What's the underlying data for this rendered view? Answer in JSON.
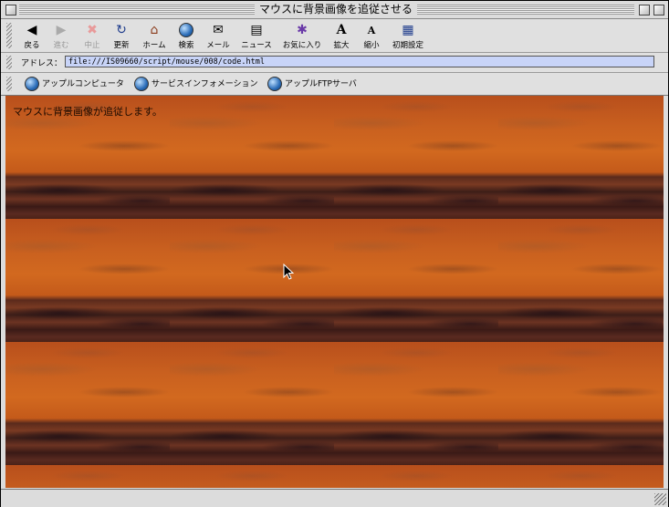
{
  "window": {
    "title": "マウスに背景画像を追従させる"
  },
  "toolbar": {
    "buttons": [
      {
        "label": "戻る",
        "icon": "back-arrow-icon"
      },
      {
        "label": "進む",
        "icon": "forward-arrow-icon"
      },
      {
        "label": "中止",
        "icon": "stop-icon"
      },
      {
        "label": "更新",
        "icon": "refresh-icon"
      },
      {
        "label": "ホーム",
        "icon": "home-icon"
      },
      {
        "label": "検索",
        "icon": "search-globe-icon"
      },
      {
        "label": "メール",
        "icon": "mail-icon"
      },
      {
        "label": "ニュース",
        "icon": "news-icon"
      },
      {
        "label": "お気に入り",
        "icon": "favorites-icon"
      },
      {
        "label": "拡大",
        "icon": "text-larger-icon"
      },
      {
        "label": "縮小",
        "icon": "text-smaller-icon"
      },
      {
        "label": "初期設定",
        "icon": "preferences-icon"
      }
    ]
  },
  "address": {
    "label": "アドレス：",
    "value": "file:///IS09660/script/mouse/008/code.html"
  },
  "favorites": {
    "items": [
      {
        "label": "アップルコンピュータ"
      },
      {
        "label": "サービスインフォメーション"
      },
      {
        "label": "アップルFTPサーバ"
      }
    ]
  },
  "content": {
    "message": "マウスに背景画像が追従します。"
  },
  "colors": {
    "sky": "#c9601f",
    "ground": "#3d1e18",
    "address_bg": "#c8d4f8"
  }
}
